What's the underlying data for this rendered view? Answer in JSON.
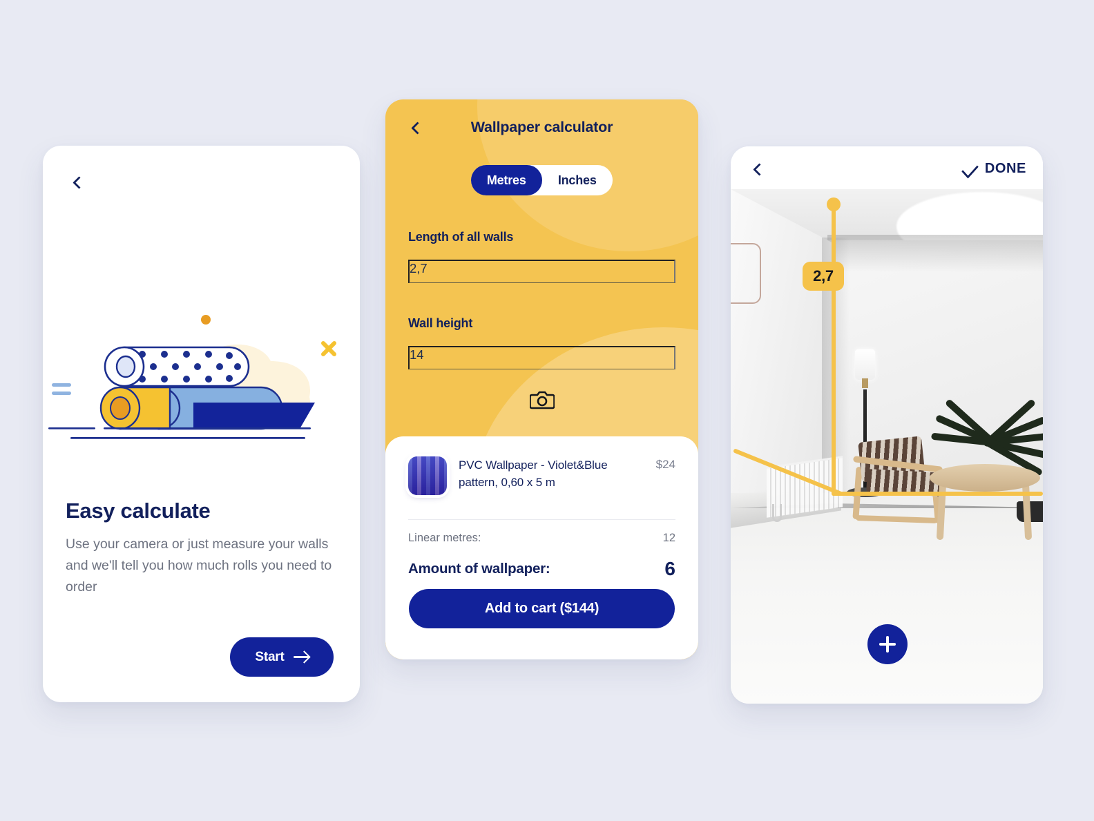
{
  "theme": {
    "page_background": "#e8eaf3",
    "brand_navy": "#12229a",
    "text_navy": "#12205c",
    "accent_yellow": "#f4c451",
    "ar_yellow": "#f5c24a",
    "muted_text": "#6d7280"
  },
  "onboarding": {
    "back_icon": "chevron-left-icon",
    "illustration": "wallpaper-rolls-illustration",
    "title": "Easy calculate",
    "subtitle": "Use your camera or just measure your walls and we'll tell you how much rolls you need to order",
    "start_label": "Start",
    "start_icon": "arrow-right-icon"
  },
  "calculator": {
    "back_icon": "chevron-left-icon",
    "title": "Wallpaper calculator",
    "units": {
      "options": [
        "Metres",
        "Inches"
      ],
      "selected": "Metres"
    },
    "fields": [
      {
        "label": "Length of all walls",
        "value": "2,7",
        "placeholder": "0"
      },
      {
        "label": "Wall height",
        "value": "14",
        "placeholder": "0"
      }
    ],
    "camera_icon": "camera-icon",
    "product": {
      "thumbnail": "wallpaper-swatch-thumbnail",
      "name": "PVC Wallpaper - Violet&Blue pattern, 0,60 x 5 m",
      "price": "$24"
    },
    "summary": [
      {
        "label": "Linear metres:",
        "value": "12"
      }
    ],
    "amount": {
      "label": "Amount of wallpaper:",
      "value": "6"
    },
    "add_to_cart_label": "Add to cart ($144)"
  },
  "ar_measure": {
    "back_icon": "chevron-left-icon",
    "done_icon": "check-icon",
    "done_label": "DONE",
    "measurement_badge": "2,7",
    "add_icon": "plus-icon",
    "scene": "living-room-camera-view"
  }
}
